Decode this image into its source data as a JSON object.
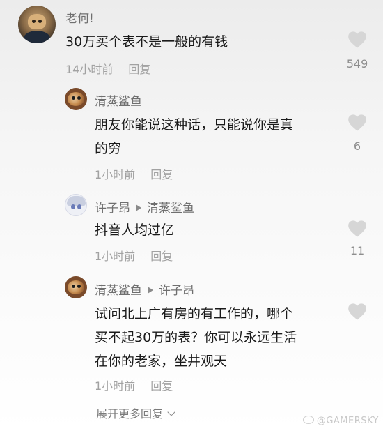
{
  "comments": [
    {
      "author": "老何!",
      "text_lines": [
        "30万买个表不是一般的有钱"
      ],
      "time": "14小时前",
      "reply_label": "回复",
      "likes": "549"
    },
    {
      "author": "清蒸鲨鱼",
      "text_lines": [
        "朋友你能说这种话，只能说你是真",
        "的穷"
      ],
      "time": "1小时前",
      "reply_label": "回复",
      "likes": "6"
    },
    {
      "author": "许子昂",
      "reply_to": "清蒸鲨鱼",
      "text_lines": [
        "抖音人均过亿"
      ],
      "time": "1小时前",
      "reply_label": "回复",
      "likes": "11"
    },
    {
      "author": "清蒸鲨鱼",
      "reply_to": "许子昂",
      "text_lines": [
        "试问北上广有房的有工作的，哪个",
        "买不起30万的表？你可以永远生活",
        "在你的老家，坐井观天"
      ],
      "time": "1小时前",
      "reply_label": "回复",
      "likes": ""
    }
  ],
  "expand_label": "展开更多回复",
  "watermark": "@GAMERSKY",
  "colors": {
    "heart": "#d6d6d6",
    "meta": "#a2a2a2"
  }
}
